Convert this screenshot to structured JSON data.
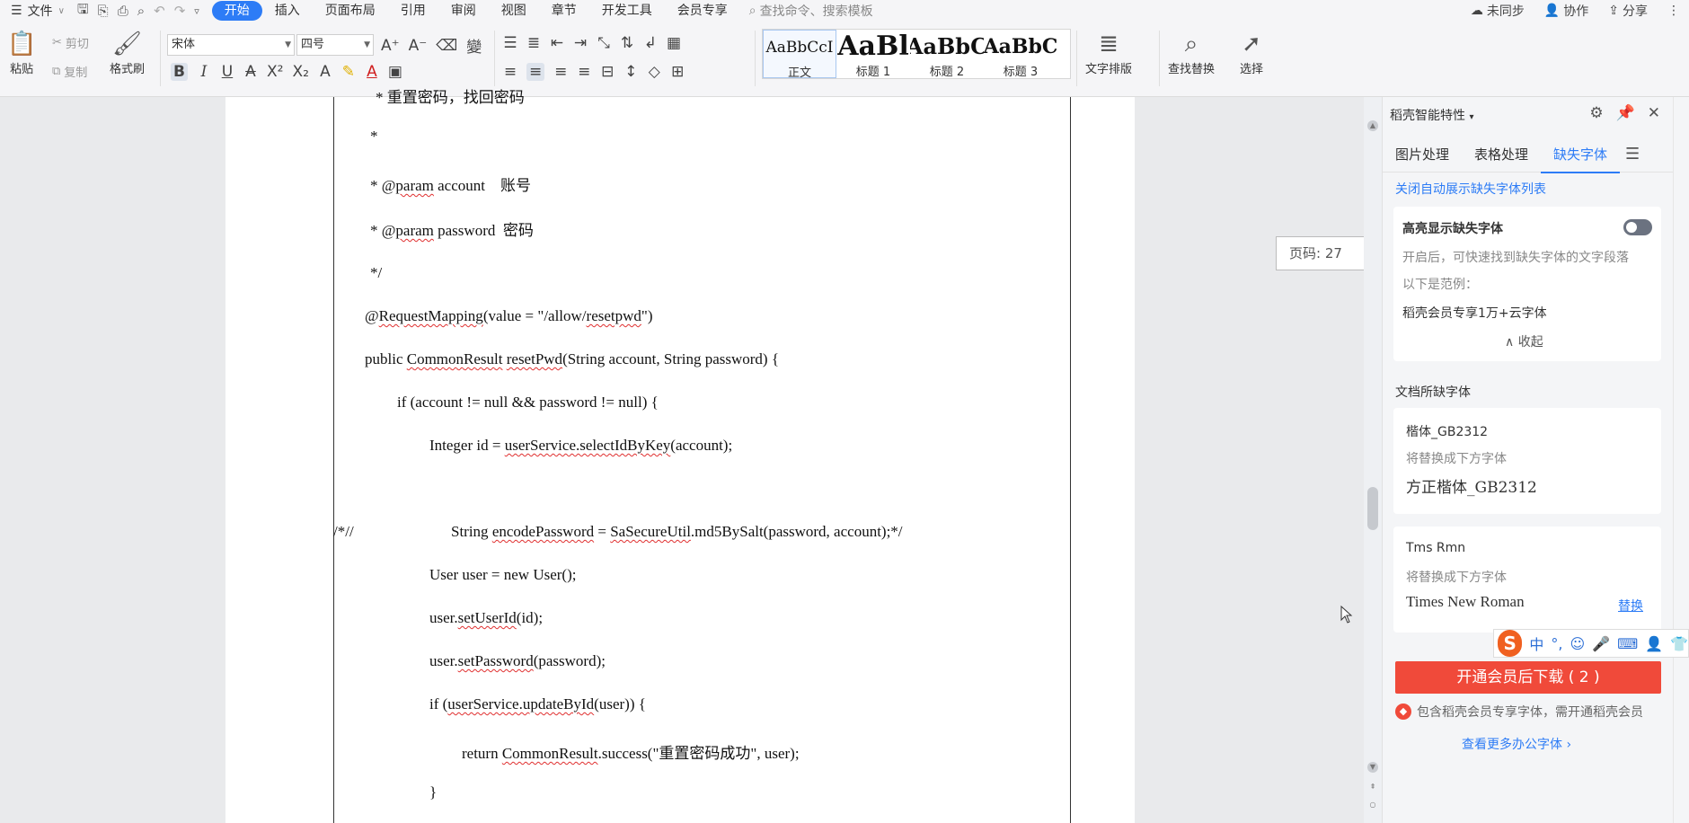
{
  "menubar": {
    "file_label": "文件",
    "tabs": [
      {
        "label": "开始",
        "active": true
      },
      {
        "label": "插入",
        "active": false
      },
      {
        "label": "页面布局",
        "active": false
      },
      {
        "label": "引用",
        "active": false
      },
      {
        "label": "审阅",
        "active": false
      },
      {
        "label": "视图",
        "active": false
      },
      {
        "label": "章节",
        "active": false
      },
      {
        "label": "开发工具",
        "active": false
      },
      {
        "label": "会员专享",
        "active": false
      }
    ],
    "search_placeholder": "查找命令、搜索模板",
    "sync_label": "未同步",
    "collab_label": "协作",
    "share_label": "分享"
  },
  "ribbon": {
    "paste_label": "粘贴",
    "cut_label": "剪切",
    "copy_label": "复制",
    "format_painter_label": "格式刷",
    "font_name": "宋体",
    "font_size": "四号",
    "styles": [
      {
        "sample": "AaBbCcI",
        "label": "正文",
        "size": 17,
        "bold": false
      },
      {
        "sample": "AaBl",
        "label": "标题 1",
        "size": 30,
        "bold": true
      },
      {
        "sample": "AaBbC",
        "label": "标题 2",
        "size": 24,
        "bold": true
      },
      {
        "sample": "AaBbC",
        "label": "标题 3",
        "size": 22,
        "bold": true
      }
    ],
    "text_layout_label": "文字排版",
    "find_replace_label": "查找替换",
    "select_label": "选择"
  },
  "document": {
    "page_indicator": "页码: 27",
    "lines": [
      {
        "segments": [
          {
            "text": "* 重置密码，找回密码",
            "sq": false
          }
        ]
      },
      {
        "segments": [
          {
            "text": "*",
            "sq": false
          }
        ]
      },
      {
        "segments": [
          {
            "text": "* @",
            "sq": false
          },
          {
            "text": "param",
            "sq": true
          },
          {
            "text": " account    账号",
            "sq": false
          }
        ]
      },
      {
        "segments": [
          {
            "text": "* @",
            "sq": false
          },
          {
            "text": "param",
            "sq": true
          },
          {
            "text": " password  密码",
            "sq": false
          }
        ]
      },
      {
        "segments": [
          {
            "text": "*/",
            "sq": false
          }
        ]
      },
      {
        "segments": [
          {
            "text": "@",
            "sq": false
          },
          {
            "text": "RequestMapping",
            "sq": true
          },
          {
            "text": "(value = \"/allow/",
            "sq": false
          },
          {
            "text": "resetpwd",
            "sq": true
          },
          {
            "text": "\")",
            "sq": false
          }
        ]
      },
      {
        "segments": [
          {
            "text": "public ",
            "sq": false
          },
          {
            "text": "CommonResult",
            "sq": true
          },
          {
            "text": " ",
            "sq": false
          },
          {
            "text": "resetPwd",
            "sq": true
          },
          {
            "text": "(String account, String password) {",
            "sq": false
          }
        ]
      },
      {
        "segments": [
          {
            "text": "if (account != null && password != null) {",
            "sq": false
          }
        ]
      },
      {
        "segments": [
          {
            "text": "Integer id = ",
            "sq": false
          },
          {
            "text": "userService.selectIdByKey",
            "sq": true
          },
          {
            "text": "(account);",
            "sq": false
          }
        ]
      },
      {
        "segments": [
          {
            "text": "/*//",
            "sq": false
          }
        ]
      },
      {
        "segments": [
          {
            "text": "String ",
            "sq": false
          },
          {
            "text": "encodePassword",
            "sq": true
          },
          {
            "text": " = ",
            "sq": false
          },
          {
            "text": "SaSecureUtil",
            "sq": true
          },
          {
            "text": ".md5BySalt(password, account);*/",
            "sq": false
          }
        ]
      },
      {
        "segments": [
          {
            "text": "User user = new User();",
            "sq": false
          }
        ]
      },
      {
        "segments": [
          {
            "text": "user.",
            "sq": false
          },
          {
            "text": "setUserId",
            "sq": true
          },
          {
            "text": "(id);",
            "sq": false
          }
        ]
      },
      {
        "segments": [
          {
            "text": "user.",
            "sq": false
          },
          {
            "text": "setPassword",
            "sq": true
          },
          {
            "text": "(password);",
            "sq": false
          }
        ]
      },
      {
        "segments": [
          {
            "text": "if (",
            "sq": false
          },
          {
            "text": "userService.updateById",
            "sq": true
          },
          {
            "text": "(user)) {",
            "sq": false
          }
        ]
      },
      {
        "segments": [
          {
            "text": "return ",
            "sq": false
          },
          {
            "text": "CommonResult",
            "sq": true
          },
          {
            "text": ".success(\"重置密码成功\", user);",
            "sq": false
          }
        ]
      },
      {
        "segments": [
          {
            "text": "}",
            "sq": false
          }
        ]
      }
    ]
  },
  "pane": {
    "title": "稻壳智能特性",
    "tabs": [
      {
        "label": "图片处理",
        "active": false
      },
      {
        "label": "表格处理",
        "active": false
      },
      {
        "label": "缺失字体",
        "active": true
      }
    ],
    "close_auto_link": "关闭自动展示缺失字体列表",
    "highlight": {
      "title": "高亮显示缺失字体",
      "desc": "开启后，可快速找到缺失字体的文字段落",
      "example_label": "以下是范例：",
      "example_text": "稻壳会员专享1万+云字体",
      "collapse_label": "收起"
    },
    "missing_section": "文档所缺字体",
    "fonts": [
      {
        "name": "楷体_GB2312",
        "hint": "将替换成下方字体",
        "replacement": "方正楷体_GB2312",
        "action": ""
      },
      {
        "name": "Tms Rmn",
        "hint": "将替换成下方字体",
        "replacement": "Times New Roman",
        "action": "替换"
      }
    ],
    "download_button": "开通会员后下载 ( 2 )",
    "note": "包含稻壳会员专享字体，需开通稻壳会员",
    "more_link": "查看更多办公字体 ›"
  },
  "ime": {
    "logo": "S",
    "mode": "中",
    "punct": "°,"
  },
  "colors": {
    "accent": "#2d7cf6",
    "download": "#f04a3a",
    "squiggle": "#e03030"
  }
}
